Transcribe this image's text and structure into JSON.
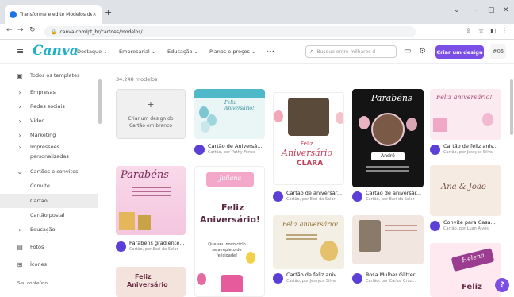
{
  "browser": {
    "tab_title": "Transforme e edite Modelos de C",
    "tab_close": "×",
    "new_tab": "+",
    "address": "canva.com/pt_br/cartoes/modelos/",
    "win_min": "⌄",
    "win_dash": "–",
    "win_max": "▢",
    "win_close": "✕"
  },
  "header": {
    "logo": "Canva",
    "menu": [
      "Destaque ⌄",
      "Empresarial ⌄",
      "Educação ⌄",
      "Planos e preços ⌄",
      "•••"
    ],
    "search_placeholder": "Busque entre milhares d",
    "create_button": "Criar um design",
    "avatar": "#05"
  },
  "sidebar": {
    "items": [
      {
        "icon": "▣",
        "label": "Todos os templates"
      },
      {
        "icon": "›",
        "label": "Empresas"
      },
      {
        "icon": "›",
        "label": "Redes sociais"
      },
      {
        "icon": "›",
        "label": "Vídeo"
      },
      {
        "icon": "›",
        "label": "Marketing"
      },
      {
        "icon": "›",
        "label": "Impressões"
      },
      {
        "icon": "",
        "label": "personalizadas"
      },
      {
        "icon": "⌄",
        "label": "Cartões e convites"
      },
      {
        "icon": "",
        "label": "Convite"
      },
      {
        "icon": "",
        "label": "Cartão"
      },
      {
        "icon": "",
        "label": "Cartão postal"
      },
      {
        "icon": "›",
        "label": "Educação"
      },
      {
        "icon": "▤",
        "label": "Fotos"
      },
      {
        "icon": "⊞",
        "label": "Ícones"
      }
    ],
    "section": "Seu conteúdo"
  },
  "main": {
    "count": "34.248 modelos",
    "blank": {
      "plus": "+",
      "line1": "Criar um design do",
      "line2": "Cartão em branco"
    },
    "cards": [
      {
        "title": "Cartão de Aniversá...",
        "sub": "Cartão, por Pathy Fente"
      },
      {
        "title": "Cartão de aniversár...",
        "sub": "Cartão, por Eari da Solar"
      },
      {
        "title": "Cartão de aniversár...",
        "sub": "Cartão, por Eari da Solar"
      },
      {
        "title": "Cartão de feliz aniv...",
        "sub": "Cartão, por Jessyca Silva"
      },
      {
        "title": "Parabéns gradiente...",
        "sub": "Cartão, por Eari da Solar"
      },
      {
        "title": "Convite para Casa...",
        "sub": "Cartão, por Luan Alves"
      },
      {
        "title": "Cartão de feliz aniv...",
        "sub": "Cartão, por Jessyca Silva"
      },
      {
        "title": "Rosa Mulher Glitter...",
        "sub": "Cartão, por Carlos Cruz..."
      }
    ],
    "art": {
      "bday_script": "Feliz Aniversário!",
      "clara_small": "Feliz",
      "clara_big": "Aniversário",
      "clara_name": "CLARA",
      "parabens": "Parabéns",
      "andre": "André",
      "feliz_aniv_script": "Feliz aniversário!",
      "ana_joao": "Ana & João",
      "parabens_script": "Parabéns",
      "juliana": "Juliana",
      "feliz_big": "Feliz",
      "aniversario_big": "Aniversário!",
      "juliana_msg": "Que seu novo ciclo seja repleto de felicidade!",
      "feliz_aniv2": "Feliz aniversário!",
      "feliz_pink": "Feliz",
      "aniv_pink": "Aniversário",
      "helena": "Helena",
      "feliz_last": "Feliz"
    },
    "help": "?"
  }
}
